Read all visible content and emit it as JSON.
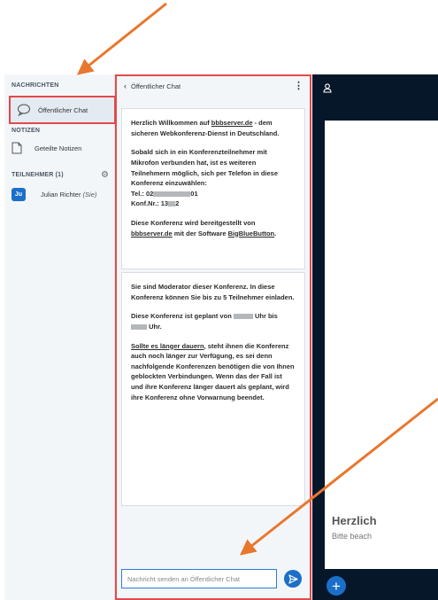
{
  "sidebar": {
    "messages_label": "NACHRICHTEN",
    "public_chat_label": "Öffentlicher Chat",
    "notes_label": "NOTIZEN",
    "shared_notes_label": "Geteilte Notizen",
    "participants_label": "TEILNEHMER (1)",
    "user": {
      "initials": "Ju",
      "name": "Julian Richter",
      "role": "(Sie)"
    }
  },
  "chat": {
    "title": "Öffentlicher Chat",
    "welcome_msg": {
      "p1_pre": "Herzlich Willkommen auf ",
      "p1_link": "bbbserver.de",
      "p1_post": " - dem sicheren Webkonferenz-Dienst in Deutschland.",
      "p2": "Sobald sich in ein Konferenzteilnehmer mit Mikrofon verbunden hat, ist es weiteren Teilnehmern möglich, sich per Telefon in diese Konferenz einzuwählen:",
      "tel_label": "Tel.: 02",
      "tel_suffix": "01",
      "conf_label": "Konf.Nr.: 13",
      "conf_suffix": "2",
      "p4_pre": "Diese Konferenz wird bereitgestellt von ",
      "p4_link1": "bbbserver.de",
      "p4_mid": " mit der Software ",
      "p4_link2": "BigBlueButton",
      "p4_post": "."
    },
    "moderator_msg": {
      "p1": "Sie sind Moderator dieser Konferenz. In diese Konferenz können Sie bis zu 5 Teilnehmer einladen.",
      "p2_pre": "Diese Konferenz ist geplant von ",
      "p2_mid": " Uhr bis ",
      "p2_post": " Uhr.",
      "p3_link": "Sollte es länger dauern",
      "p3_rest": ", steht ihnen die Konferenz auch noch länger zur Verfügung, es sei denn nachfolgende Konferenzen benötigen die von Ihnen geblockten Verbindungen. Wenn das der Fall ist und ihre Konferenz länger dauert als geplant, wird ihre Konferenz ohne Vorwarnung beendet."
    },
    "input_placeholder": "Nachricht senden an Öffentlicher Chat"
  },
  "presentation": {
    "welcome_title": "Herzlich",
    "welcome_sub": "Bitte beach"
  },
  "colors": {
    "annotation_arrow": "#e8772e",
    "highlight_border": "#e24a4a",
    "accent_blue": "#1b6fc8",
    "presentation_bg": "#06172a"
  }
}
